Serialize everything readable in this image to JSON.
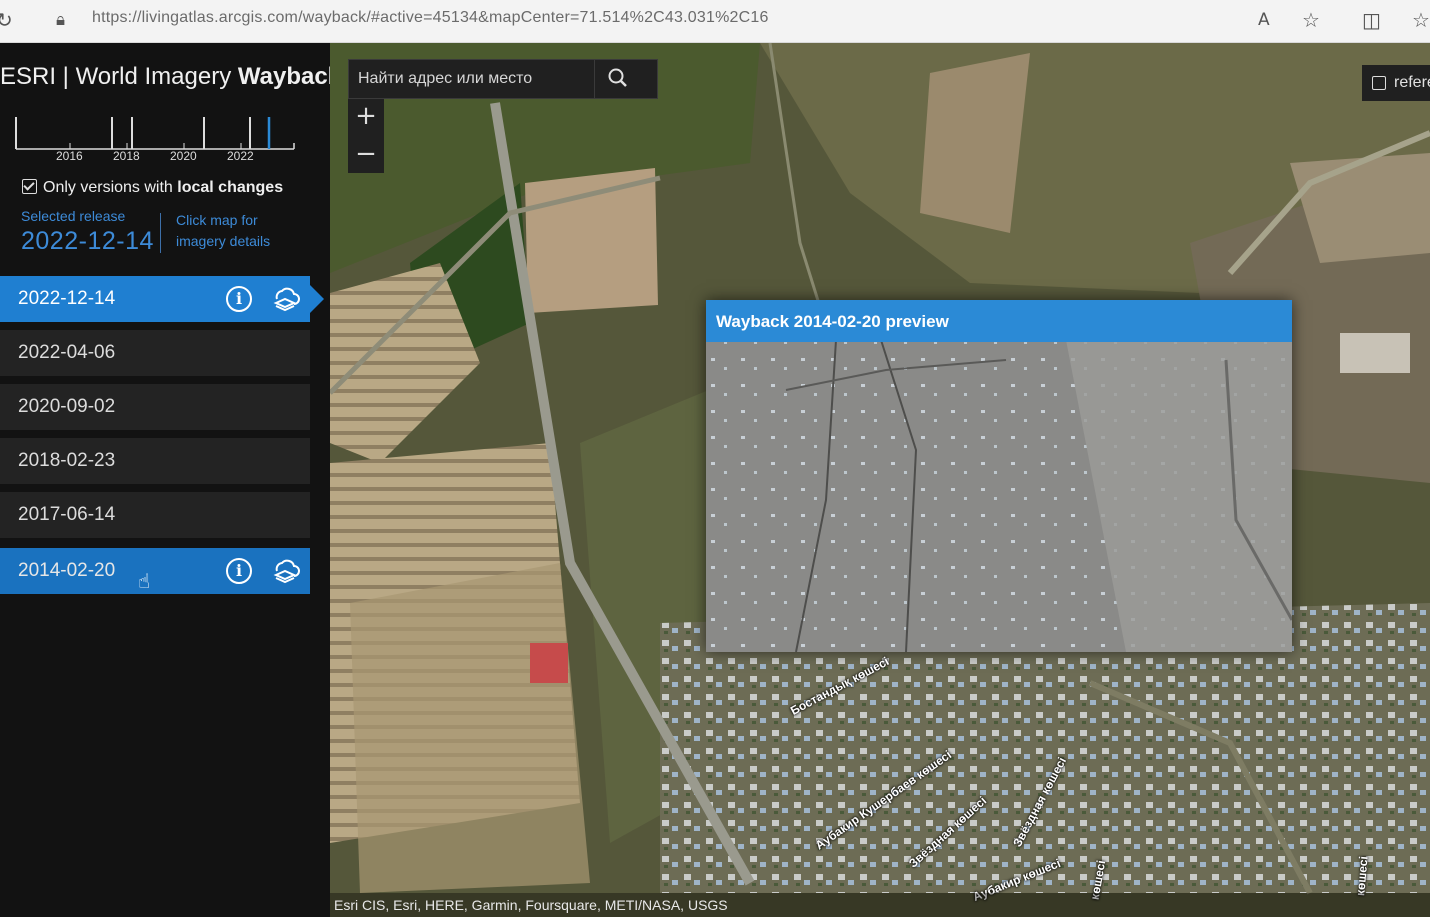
{
  "browser": {
    "url": "https://livingatlas.arcgis.com/wayback/#active=45134&mapCenter=71.514%2C43.031%2C16"
  },
  "sidebar": {
    "title_light": "ESRI | World Imagery ",
    "title_bold": "Wayback",
    "timeline_years": [
      "2016",
      "2018",
      "2020",
      "2022"
    ],
    "local_changes_prefix": "Only versions with ",
    "local_changes_bold": "local changes",
    "selected_release_label": "Selected release",
    "selected_release_date": "2022-12-14",
    "click_hint": "Click map for imagery details",
    "releases": [
      {
        "date": "2022-12-14",
        "state": "active"
      },
      {
        "date": "2022-04-06",
        "state": "normal"
      },
      {
        "date": "2020-09-02",
        "state": "normal"
      },
      {
        "date": "2018-02-23",
        "state": "normal"
      },
      {
        "date": "2017-06-14",
        "state": "normal"
      },
      {
        "date": "2014-02-20",
        "state": "hover"
      }
    ]
  },
  "map": {
    "search_placeholder": "Найти адрес или место",
    "zoom_in": "+",
    "zoom_out": "−",
    "reference_label": "refere",
    "preview_title": "Wayback 2014-02-20 preview",
    "streets": [
      "Бостандық көшесі",
      "Аубакир Кушербаев көшесі",
      "Звёздная көшесі",
      "Звёздная көшесі",
      "Аубакир көшесі",
      "көшесі",
      "көшесі"
    ],
    "attribution": "Esri CIS, Esri, HERE, Garmin, Foursquare, METI/NASA, USGS"
  },
  "colors": {
    "accent": "#1f7fd1",
    "selected_text": "#3d8bd8",
    "sidebar_bg": "#121212",
    "row_bg": "#232323"
  }
}
